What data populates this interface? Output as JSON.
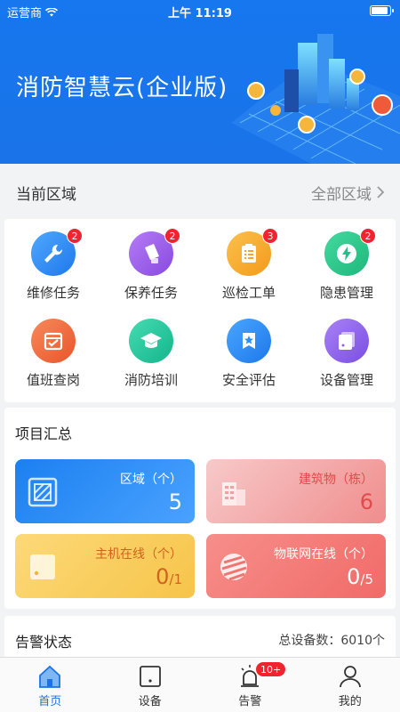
{
  "status_bar": {
    "carrier": "运营商",
    "time": "上午 11:19"
  },
  "header": {
    "title": "消防智慧云(企业版)"
  },
  "region": {
    "label": "当前区域",
    "value": "全部区域"
  },
  "functions": [
    {
      "label": "维修任务",
      "badge": "2",
      "color": "#2f8cf0",
      "icon": "wrench-icon"
    },
    {
      "label": "保养任务",
      "badge": "2",
      "color": "#9a5ce6",
      "icon": "maintenance-icon"
    },
    {
      "label": "巡检工单",
      "badge": "3",
      "color": "#f5a623",
      "icon": "clipboard-icon"
    },
    {
      "label": "隐患管理",
      "badge": "2",
      "color": "#27c28c",
      "icon": "lightning-icon"
    },
    {
      "label": "值班查岗",
      "badge": "",
      "color": "#ef6a3d",
      "icon": "duty-calendar-icon"
    },
    {
      "label": "消防培训",
      "badge": "",
      "color": "#22c39a",
      "icon": "graduation-cap-icon"
    },
    {
      "label": "安全评估",
      "badge": "",
      "color": "#2a8ff0",
      "icon": "shield-star-icon"
    },
    {
      "label": "设备管理",
      "badge": "",
      "color": "#8e63e8",
      "icon": "device-icon"
    }
  ],
  "summary": {
    "title": "项目汇总",
    "tiles": [
      {
        "label": "区域（个）",
        "value": "5",
        "suffix": ""
      },
      {
        "label": "建筑物（栋）",
        "value": "6",
        "suffix": ""
      },
      {
        "label": "主机在线（个）",
        "value": "0",
        "suffix": "/1"
      },
      {
        "label": "物联网在线（个）",
        "value": "0",
        "suffix": "/5"
      }
    ]
  },
  "alert": {
    "title": "告警状态",
    "total": "总设备数：6010个"
  },
  "tabs": [
    {
      "label": "首页",
      "active": true
    },
    {
      "label": "设备",
      "active": false
    },
    {
      "label": "告警",
      "active": false,
      "badge": "10+"
    },
    {
      "label": "我的",
      "active": false
    }
  ]
}
